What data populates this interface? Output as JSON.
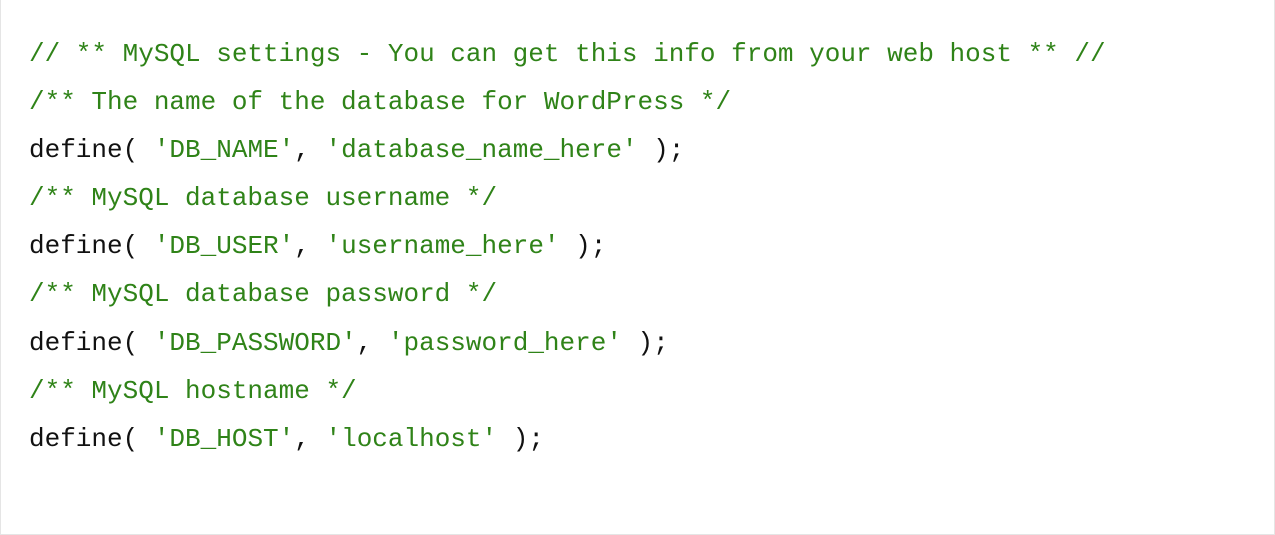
{
  "code": {
    "comment_header": "// ** MySQL settings - You can get this info from your web host ** //",
    "comment_dbname": "/** The name of the database for WordPress */",
    "def1_kw": "define( ",
    "def1_arg1": "'DB_NAME'",
    "def1_sep": ", ",
    "def1_arg2": "'database_name_here'",
    "def1_end": " );",
    "comment_user": "/** MySQL database username */",
    "def2_kw": "define( ",
    "def2_arg1": "'DB_USER'",
    "def2_sep": ", ",
    "def2_arg2": "'username_here'",
    "def2_end": " );",
    "comment_pass": "/** MySQL database password */",
    "def3_kw": "define( ",
    "def3_arg1": "'DB_PASSWORD'",
    "def3_sep": ", ",
    "def3_arg2": "'password_here'",
    "def3_end": " );",
    "comment_host": "/** MySQL hostname */",
    "def4_kw": "define( ",
    "def4_arg1": "'DB_HOST'",
    "def4_sep": ", ",
    "def4_arg2": "'localhost'",
    "def4_end": " );"
  }
}
